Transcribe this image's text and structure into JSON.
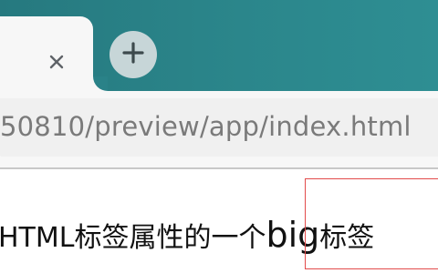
{
  "tabs": {
    "close_icon": "close-icon",
    "new_tab_icon": "plus-icon"
  },
  "address_bar": {
    "url": "50810/preview/app/index.html"
  },
  "page": {
    "text_before": "HTML标签属性的一个",
    "emphasis_word": "big",
    "text_after": "标签"
  },
  "colors": {
    "tab_strip": "#2a8288",
    "tab_background": "#f7f7f7",
    "omnibox_background": "#f0f0f0",
    "highlight_border": "#e24b4b"
  }
}
